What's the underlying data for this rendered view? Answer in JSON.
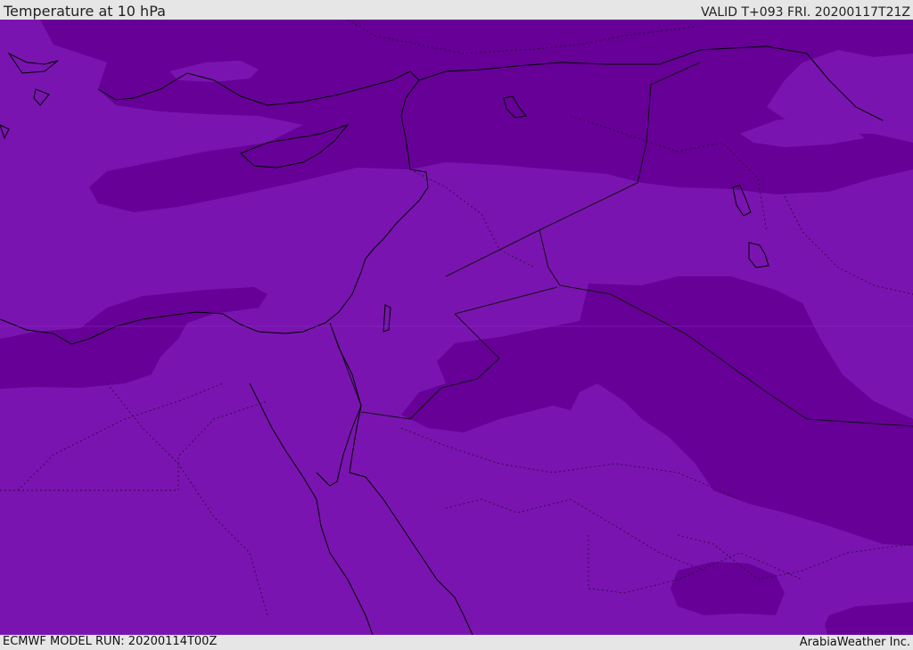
{
  "header": {
    "title": "Temperature at 10 hPa",
    "valid": "VALID T+093 FRI. 20200117T21Z"
  },
  "footer": {
    "model_run": "ECMWF MODEL RUN: 20200114T00Z",
    "credit": "ArabiaWeather Inc."
  },
  "map": {
    "field": "Temperature at 10 hPa",
    "colors": {
      "base_fill": "#7a14b0",
      "dark_fill": "#660097",
      "coastline": "#000000",
      "border": "#222222"
    }
  }
}
